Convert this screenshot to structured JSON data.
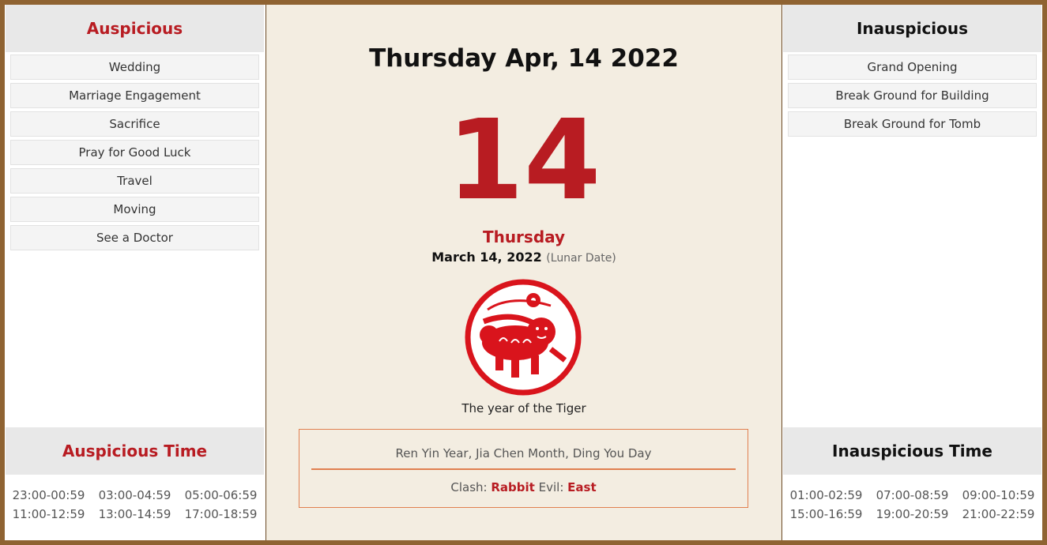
{
  "auspicious": {
    "title": "Auspicious",
    "items": [
      "Wedding",
      "Marriage Engagement",
      "Sacrifice",
      "Pray for Good Luck",
      "Travel",
      "Moving",
      "See a Doctor"
    ]
  },
  "auspicious_time": {
    "title": "Auspicious Time",
    "slots": [
      "23:00-00:59",
      "03:00-04:59",
      "05:00-06:59",
      "11:00-12:59",
      "13:00-14:59",
      "17:00-18:59"
    ]
  },
  "inauspicious": {
    "title": "Inauspicious",
    "items": [
      "Grand Opening",
      "Break Ground for Building",
      "Break Ground for Tomb"
    ]
  },
  "inauspicious_time": {
    "title": "Inauspicious Time",
    "slots": [
      "01:00-02:59",
      "07:00-08:59",
      "09:00-10:59",
      "15:00-16:59",
      "19:00-20:59",
      "21:00-22:59"
    ]
  },
  "center": {
    "date_title": "Thursday Apr, 14 2022",
    "day_number": "14",
    "weekday": "Thursday",
    "lunar_date": "March 14, 2022",
    "lunar_label": "(Lunar Date)",
    "zodiac_icon": "tiger-papercut-icon",
    "zodiac_caption": "The year of the Tiger",
    "ganzhi": "Ren Yin Year, Jia Chen Month, Ding You Day",
    "clash_label": "Clash:",
    "clash_value": "Rabbit",
    "evil_label": "Evil:",
    "evil_value": "East"
  },
  "colors": {
    "accent_red": "#b81c22",
    "frame_brown": "#8f6332",
    "info_border": "#e08050"
  }
}
